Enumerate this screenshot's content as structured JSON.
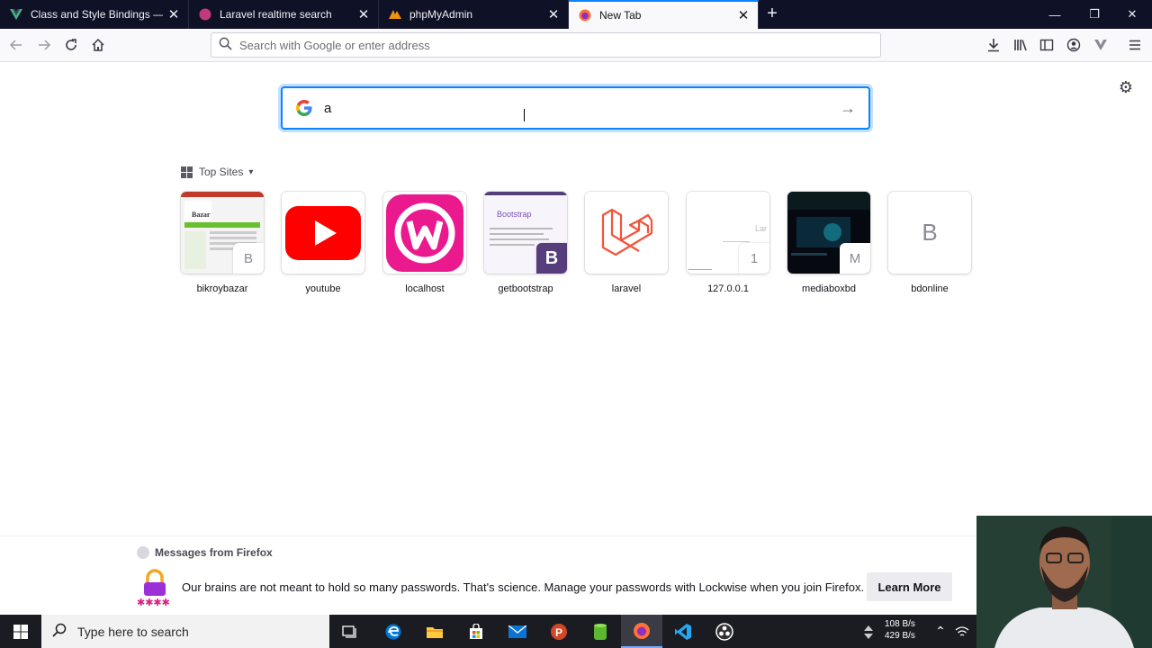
{
  "tabs": [
    {
      "label": "Class and Style Bindings — Vue.js",
      "icon": "vue-favicon",
      "active": false
    },
    {
      "label": "Laravel realtime search",
      "icon": "laravel-favicon",
      "active": false
    },
    {
      "label": "phpMyAdmin",
      "icon": "phpmyadmin-favicon",
      "active": false
    },
    {
      "label": "New Tab",
      "icon": "firefox-favicon",
      "active": true
    }
  ],
  "urlbar": {
    "placeholder": "Search with Google or enter address"
  },
  "search": {
    "value": "a"
  },
  "topsites": {
    "header": "Top Sites",
    "sites": [
      {
        "name": "bikroybazar",
        "badge": "B"
      },
      {
        "name": "youtube",
        "badge": ""
      },
      {
        "name": "localhost",
        "badge": ""
      },
      {
        "name": "getbootstrap",
        "badge": "B"
      },
      {
        "name": "laravel",
        "badge": ""
      },
      {
        "name": "127.0.0.1",
        "badge": "1"
      },
      {
        "name": "mediaboxbd",
        "badge": "M"
      },
      {
        "name": "bdonline",
        "badge": "B"
      }
    ]
  },
  "messages": {
    "header": "Messages from Firefox",
    "text": "Our brains are not meant to hold so many passwords. That's science. Manage your passwords with Lockwise when you join Firefox.",
    "button": "Learn More"
  },
  "taskbar": {
    "search_placeholder": "Type here to search",
    "net_up": "108 B/s",
    "net_down": "429 B/s"
  },
  "colors": {
    "accent": "#0a84ff",
    "tabstrip": "#0f1126"
  }
}
